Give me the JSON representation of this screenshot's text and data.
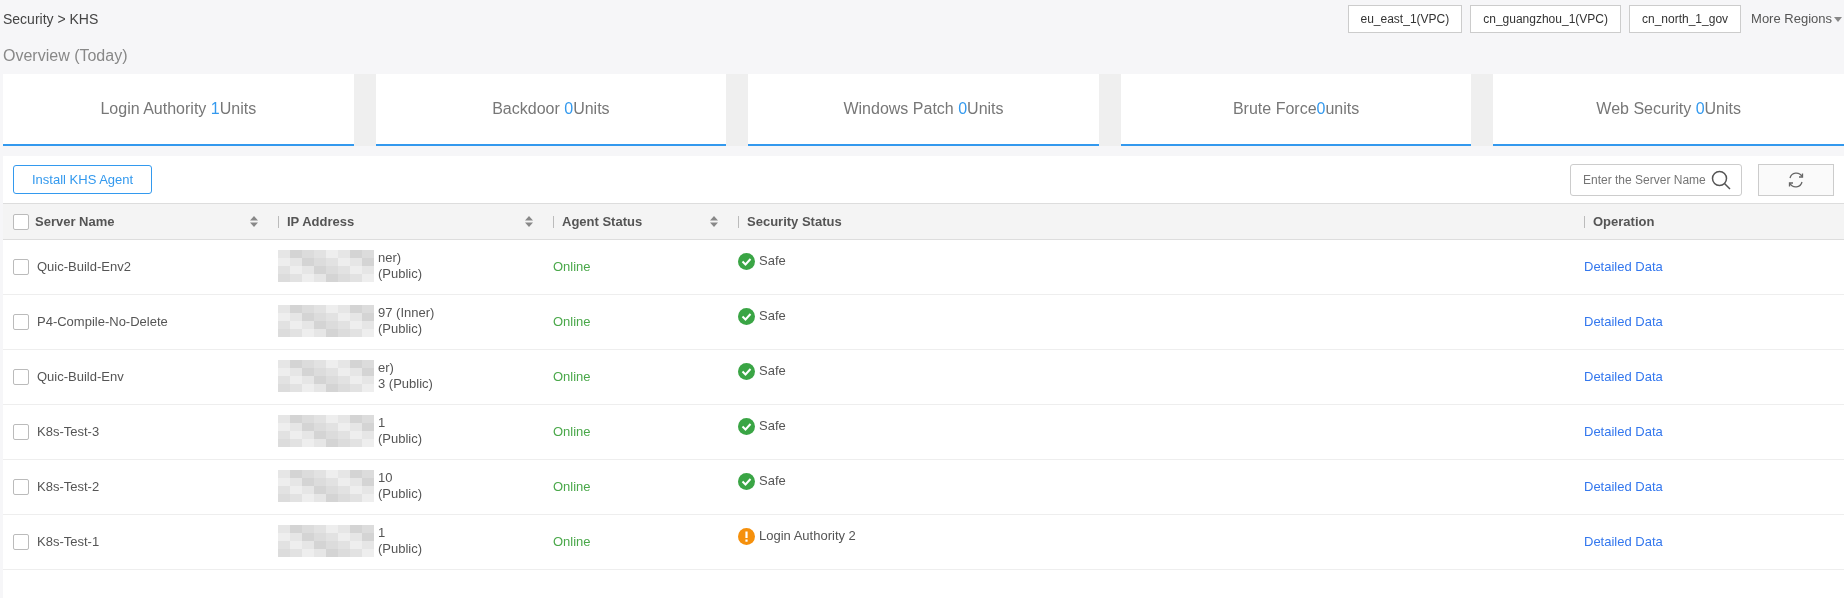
{
  "breadcrumb": "Security > KHS",
  "regions": [
    {
      "label": "eu_east_1(VPC)"
    },
    {
      "label": "cn_guangzhou_1(VPC)"
    },
    {
      "label": "cn_north_1_gov"
    }
  ],
  "more_regions": "More Regions",
  "overview_title": "Overview (Today)",
  "summary_cards": [
    {
      "label": "Login Authority ",
      "count": "1",
      "unit": "Units"
    },
    {
      "label": "Backdoor ",
      "count": "0",
      "unit": "Units"
    },
    {
      "label": "Windows Patch ",
      "count": "0",
      "unit": "Units"
    },
    {
      "label": "Brute Force",
      "count": "0",
      "unit": "units"
    },
    {
      "label": "Web Security ",
      "count": "0",
      "unit": "Units"
    }
  ],
  "install_button": "Install KHS Agent",
  "search": {
    "placeholder": "Enter the Server Name"
  },
  "table": {
    "select_all_checked": false,
    "columns": [
      {
        "label": "Server Name",
        "sortable": true
      },
      {
        "label": "IP Address",
        "sortable": true
      },
      {
        "label": "Agent Status",
        "sortable": true
      },
      {
        "label": "Security Status",
        "sortable": false
      },
      {
        "label": "Operation",
        "sortable": false
      }
    ],
    "rows": [
      {
        "checked": false,
        "server_name": "Quic-Build-Env2",
        "ip_line_1": "ner)",
        "ip_line_2": "(Public)",
        "agent_status": "Online",
        "security": {
          "kind": "safe",
          "text": "Safe"
        },
        "operation": "Detailed Data"
      },
      {
        "checked": false,
        "server_name": "P4-Compile-No-Delete",
        "ip_line_1": "97 (Inner)",
        "ip_line_2": "(Public)",
        "agent_status": "Online",
        "security": {
          "kind": "safe",
          "text": "Safe"
        },
        "operation": "Detailed Data"
      },
      {
        "checked": false,
        "server_name": "Quic-Build-Env",
        "ip_line_1": "er)",
        "ip_line_2": "3 (Public)",
        "agent_status": "Online",
        "security": {
          "kind": "safe",
          "text": "Safe"
        },
        "operation": "Detailed Data"
      },
      {
        "checked": false,
        "server_name": "K8s-Test-3",
        "ip_line_1": "1",
        "ip_line_2": "(Public)",
        "agent_status": "Online",
        "security": {
          "kind": "safe",
          "text": "Safe"
        },
        "operation": "Detailed Data"
      },
      {
        "checked": false,
        "server_name": "K8s-Test-2",
        "ip_line_1": "10",
        "ip_line_2": "(Public)",
        "agent_status": "Online",
        "security": {
          "kind": "safe",
          "text": "Safe"
        },
        "operation": "Detailed Data"
      },
      {
        "checked": false,
        "server_name": "K8s-Test-1",
        "ip_line_1": "1",
        "ip_line_2": "(Public)",
        "agent_status": "Online",
        "security": {
          "kind": "warning",
          "text": "Login Authority 2"
        },
        "operation": "Detailed Data"
      }
    ]
  }
}
